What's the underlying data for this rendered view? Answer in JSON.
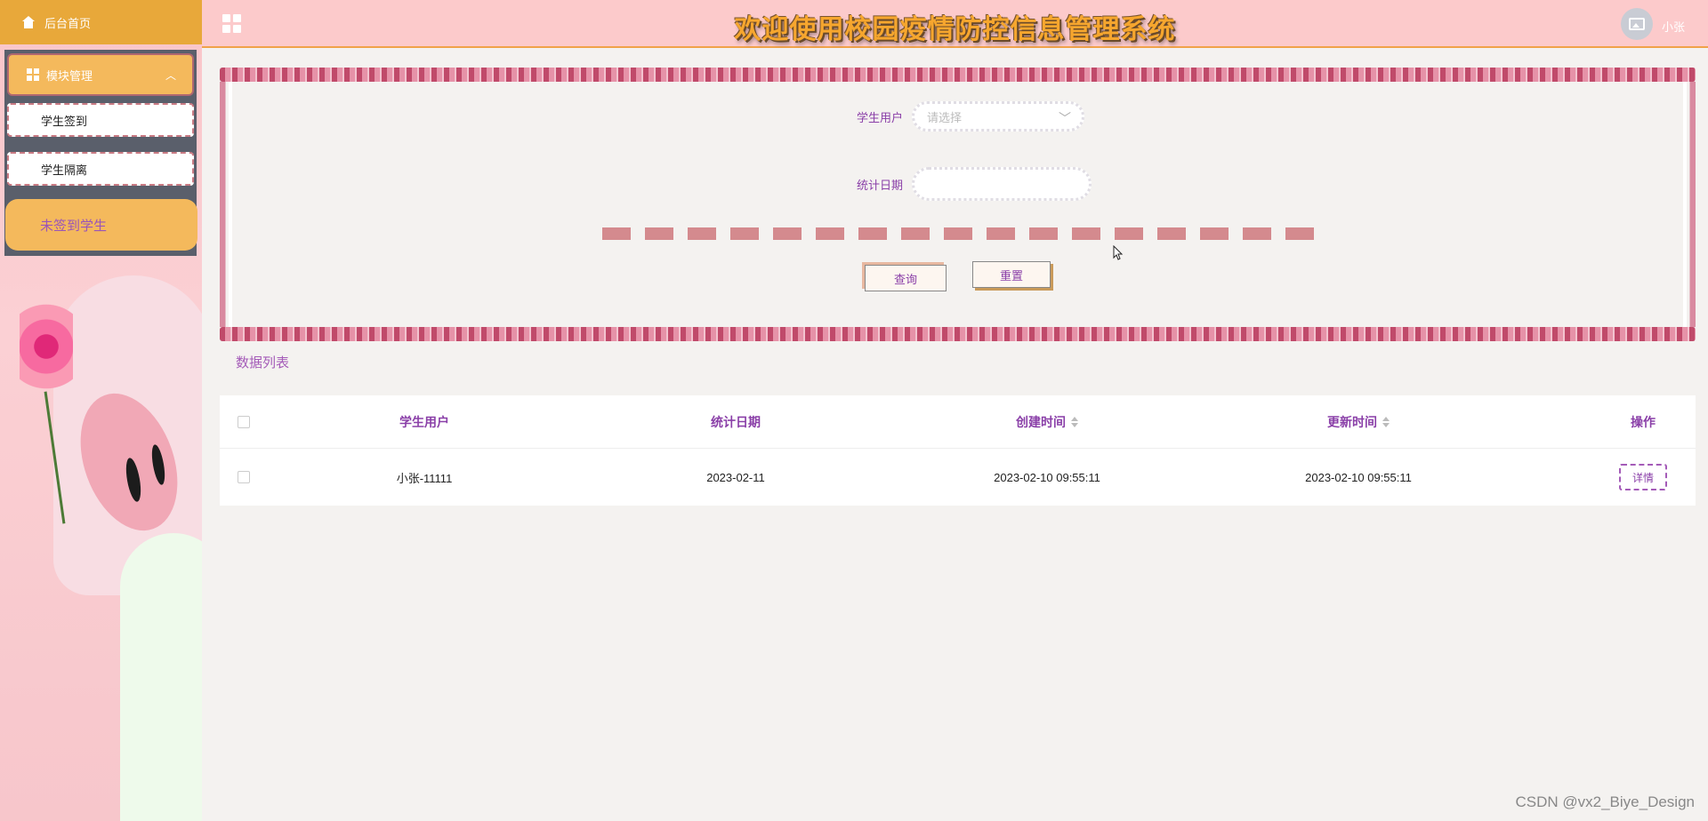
{
  "sidebar": {
    "home_label": "后台首页",
    "module_label": "模块管理",
    "items": [
      {
        "label": "学生签到"
      },
      {
        "label": "学生隔离"
      },
      {
        "label": "未签到学生"
      }
    ]
  },
  "header": {
    "title": "欢迎使用校园疫情防控信息管理系统",
    "username": "小张"
  },
  "search": {
    "student_label": "学生用户",
    "student_placeholder": "请选择",
    "date_label": "统计日期",
    "query_button": "查询",
    "reset_button": "重置"
  },
  "list": {
    "title": "数据列表",
    "columns": [
      "学生用户",
      "统计日期",
      "创建时间",
      "更新时间",
      "操作"
    ],
    "rows": [
      {
        "student": "小张-11111",
        "date": "2023-02-11",
        "created": "2023-02-10 09:55:11",
        "updated": "2023-02-10 09:55:11",
        "action": "详情"
      }
    ]
  },
  "watermark": "CSDN @vx2_Biye_Design",
  "colors": {
    "accent": "#f4b95c",
    "header_bg": "#fccacb",
    "label_purple": "#8a3fa8"
  }
}
